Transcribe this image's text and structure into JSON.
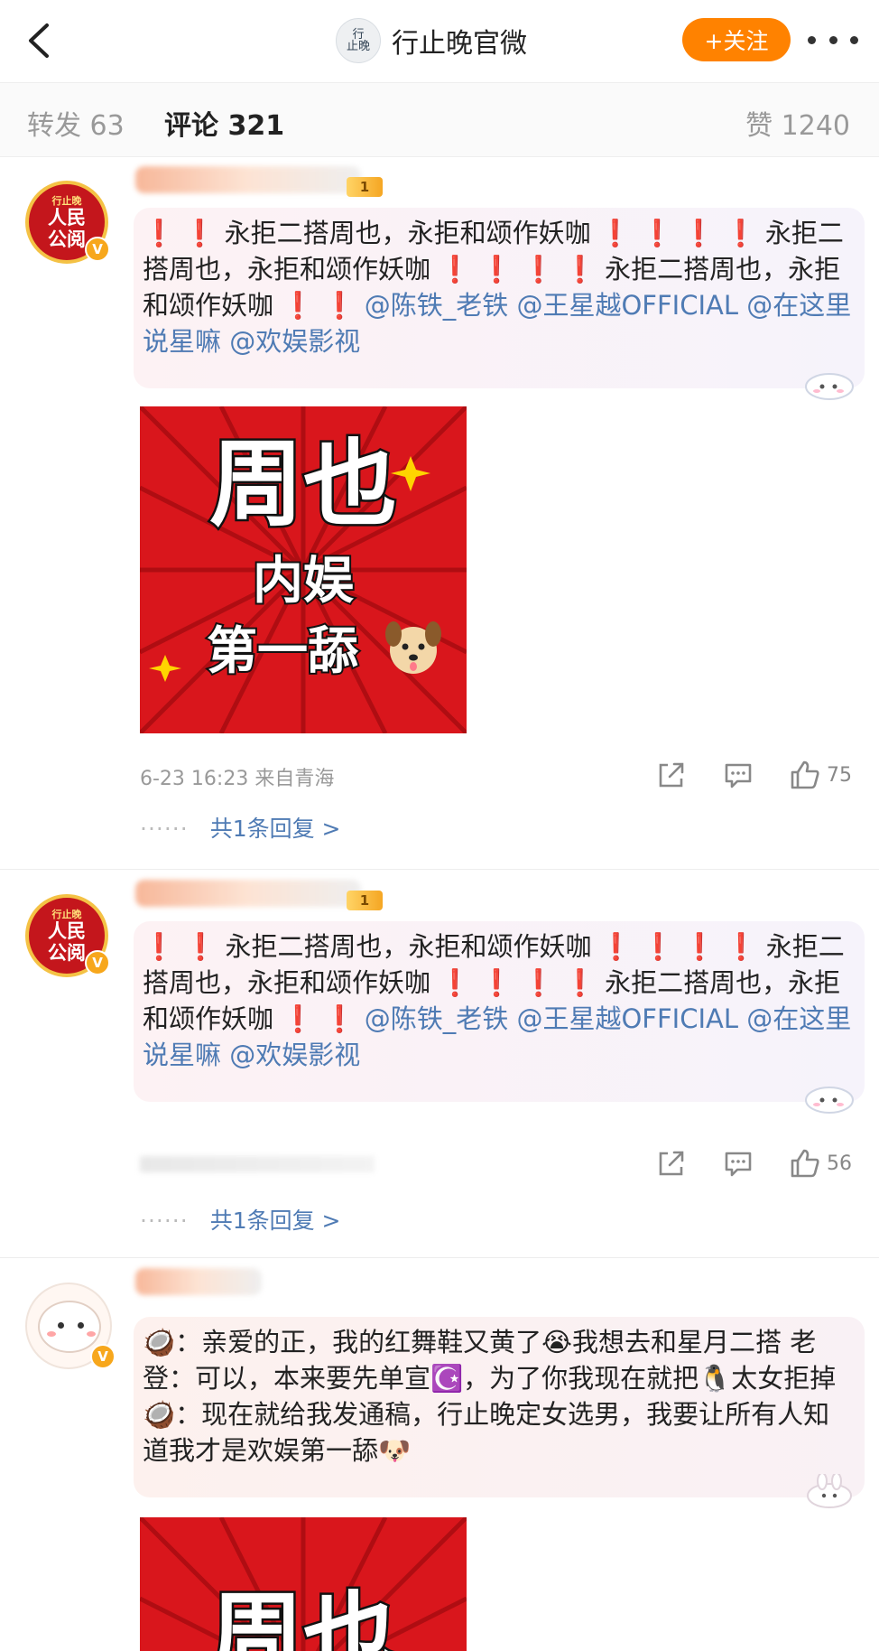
{
  "header": {
    "title": "行止晚官微",
    "avatar_text": [
      "行",
      "止",
      "晚"
    ],
    "follow_label": "+关注"
  },
  "tabs": {
    "repost_label": "转发 63",
    "comment_label": "评论 321",
    "like_label": "赞 1240"
  },
  "badge_avatar": {
    "line1": "行止晚",
    "line2": "人民",
    "line3": "公阅",
    "verified": "V"
  },
  "level_badge": "1",
  "comments": [
    {
      "text_parts": [
        {
          "t": "❗ ❗ 永拒二搭周也，永拒和颂作妖咖 ",
          "type": "text"
        },
        {
          "t": "❗ ❗ ❗ ❗",
          "type": "bang"
        },
        {
          "t": " 永拒二搭周也，永拒和颂作妖咖 ",
          "type": "text"
        },
        {
          "t": "❗ ❗ ❗ ❗",
          "type": "bang"
        },
        {
          "t": " 永拒二搭周也，永拒和颂作妖咖 ",
          "type": "text"
        },
        {
          "t": "❗ ❗",
          "type": "bang"
        },
        {
          "t": " @陈铁_老铁 @王星越OFFICIAL @在这里说星嘛 @欢娱影视",
          "type": "at"
        }
      ],
      "image": {
        "line1": "周也",
        "line2": "内娱",
        "line3": "第一舔"
      },
      "meta": "6-23 16:23 来自青海",
      "like_count": "75",
      "replies_label": "共1条回复 >",
      "dots": "······"
    },
    {
      "text_parts": [
        {
          "t": "❗ ❗",
          "type": "bang"
        },
        {
          "t": " 永拒二搭周也，永拒和颂作妖咖 ",
          "type": "text"
        },
        {
          "t": "❗ ❗ ❗ ❗",
          "type": "bang"
        },
        {
          "t": " 永拒二搭周也，永拒和颂作妖咖 ",
          "type": "text"
        },
        {
          "t": "❗ ❗ ❗ ❗",
          "type": "bang"
        },
        {
          "t": " 永拒二搭周也，永拒和颂作妖咖 ",
          "type": "text"
        },
        {
          "t": "❗ ❗",
          "type": "bang"
        },
        {
          "t": " @陈铁_老铁 @王星越OFFICIAL @在这里说星嘛 @欢娱影视",
          "type": "at"
        }
      ],
      "like_count": "56",
      "replies_label": "共1条回复 >",
      "dots": "······"
    },
    {
      "text": "🥥：亲爱的正，我的红舞鞋又黄了😭我想去和星月二搭 老登：可以，本来要先单宣☪️，为了你我现在就把🐧太女拒掉 🥥：现在就给我发通稿，行止晚定女选男，我要让所有人知道我才是欢娱第一舔🐶",
      "image": {
        "line1": "周也"
      }
    }
  ],
  "icons": {
    "back": "chevron-left-icon",
    "more": "more-dots-icon",
    "share": "share-icon",
    "comment": "comment-icon",
    "like": "thumbs-up-icon"
  },
  "colors": {
    "accent_orange": "#ff8200",
    "link_blue": "#4f7bb4",
    "alert_red": "#e0211c",
    "poster_red": "#d9161c"
  }
}
